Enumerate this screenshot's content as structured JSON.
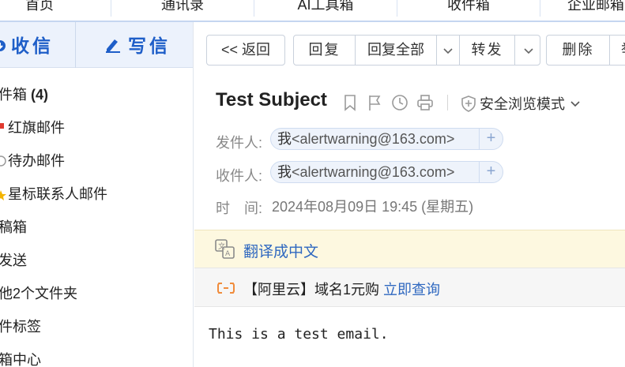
{
  "top_nav": {
    "tabs": [
      "首页",
      "通讯录",
      "AI工具箱",
      "收件箱",
      "企业邮箱"
    ]
  },
  "sidebar": {
    "receive_label": "收信",
    "compose_label": "写信",
    "folders": [
      {
        "label": "件箱",
        "count": "(4)"
      },
      {
        "label": "红旗邮件"
      },
      {
        "label": "待办邮件"
      },
      {
        "label": "星标联系人邮件"
      },
      {
        "label": "稿箱"
      },
      {
        "label": "发送"
      },
      {
        "label": "他2个文件夹"
      },
      {
        "label": "件标签"
      },
      {
        "label": "箱中心"
      }
    ]
  },
  "toolbar": {
    "back_label": "<< 返回",
    "reply_label": "回复",
    "reply_all_label": "回复全部",
    "forward_label": "转发",
    "delete_label": "删除",
    "more_label": "举"
  },
  "email": {
    "subject": "Test Subject",
    "safe_mode_label": "安全浏览模式",
    "from_label": "发件人:",
    "from_name": "我",
    "from_addr": "<alertwarning@163.com>",
    "to_label": "收件人:",
    "to_name": "我",
    "to_addr": "<alertwarning@163.com>",
    "time_label": "时　间:",
    "time_value": "2024年08月09日 19:45 (星期五)",
    "translate_label": "翻译成中文",
    "ad_text": "【阿里云】域名1元购",
    "ad_link": "立即查询",
    "body": "This is a test email."
  },
  "colors": {
    "accent": "#1e5ec8",
    "link": "#2f68c0",
    "ad_icon": "#f08c3c"
  }
}
